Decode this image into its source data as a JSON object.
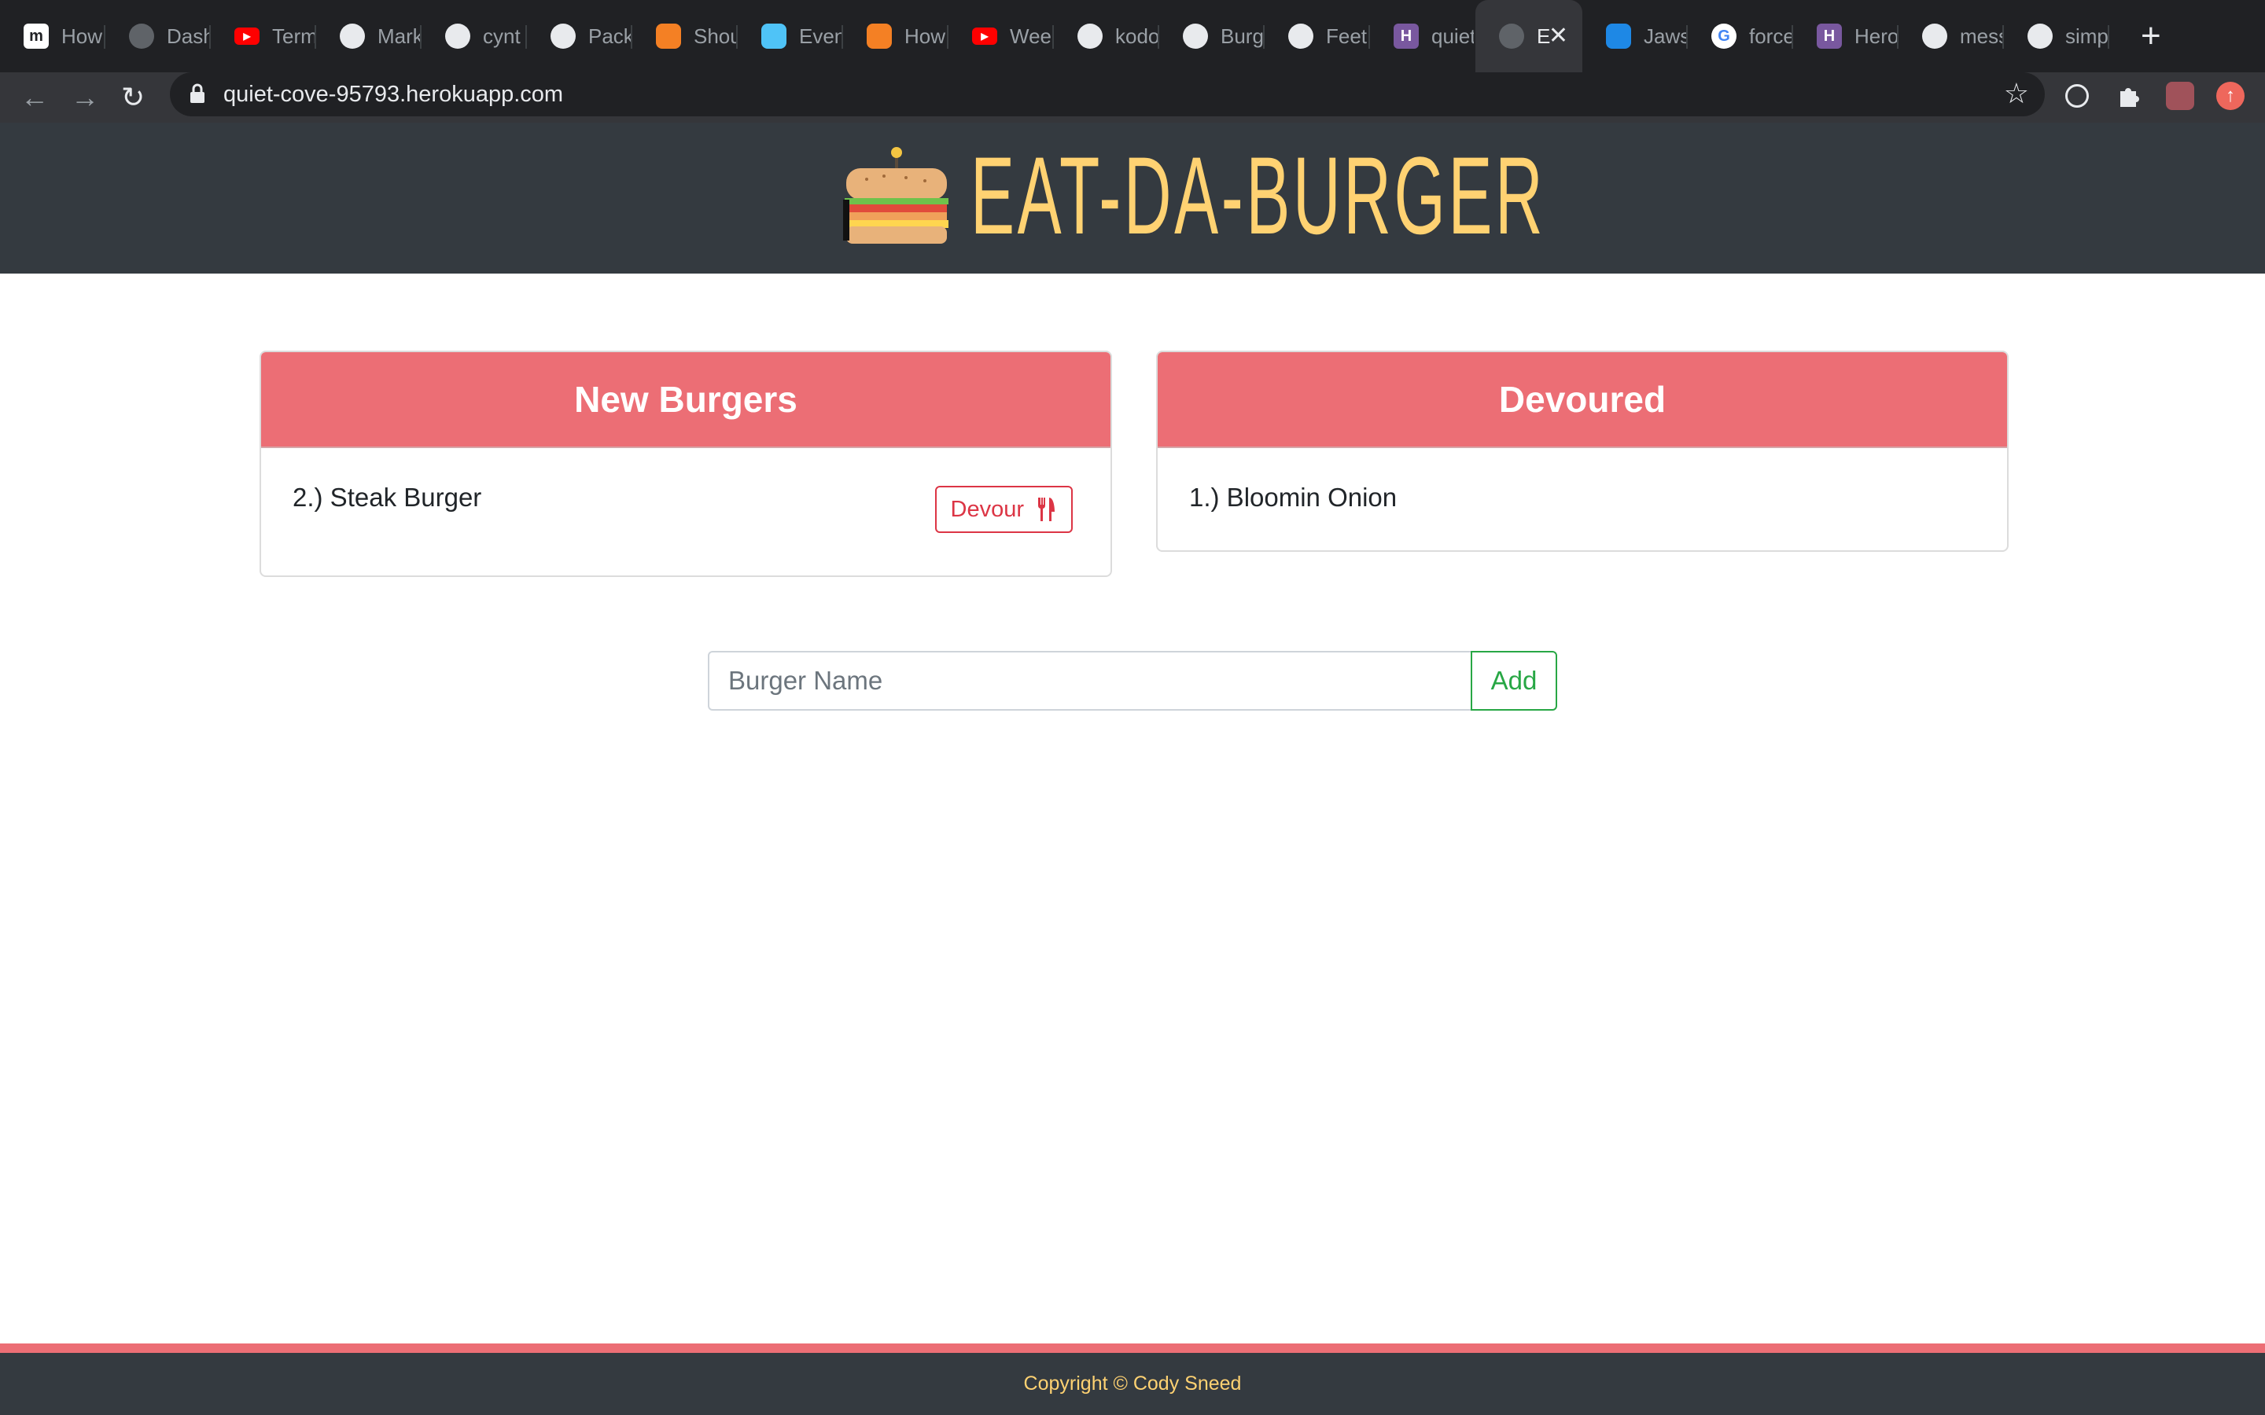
{
  "browser": {
    "tabs": [
      {
        "title": "How",
        "icon": "m-letter-icon",
        "color": "#ffffff"
      },
      {
        "title": "Dash",
        "icon": "globe-icon",
        "color": "#5f6368"
      },
      {
        "title": "Term",
        "icon": "youtube-icon",
        "color": "#ff0000"
      },
      {
        "title": "Mark",
        "icon": "github-icon",
        "color": "#e8eaed"
      },
      {
        "title": "cynt",
        "icon": "github-icon",
        "color": "#e8eaed"
      },
      {
        "title": "Pack",
        "icon": "github-icon",
        "color": "#e8eaed"
      },
      {
        "title": "Shou",
        "icon": "stackoverflow-icon",
        "color": "#f48024"
      },
      {
        "title": "Even",
        "icon": "bird-icon",
        "color": "#4fc3f7"
      },
      {
        "title": "How",
        "icon": "stackoverflow-icon",
        "color": "#f48024"
      },
      {
        "title": "Weel",
        "icon": "youtube-icon",
        "color": "#ff0000"
      },
      {
        "title": "kodo",
        "icon": "github-icon",
        "color": "#e8eaed"
      },
      {
        "title": "Burg",
        "icon": "github-icon",
        "color": "#e8eaed"
      },
      {
        "title": "Feet",
        "icon": "github-icon",
        "color": "#e8eaed"
      },
      {
        "title": "quiet",
        "icon": "heroku-icon",
        "color": "#79589f"
      },
      {
        "title": "E",
        "icon": "globe-icon",
        "color": "#5f6368",
        "active": true
      },
      {
        "title": "Jaws",
        "icon": "jaws-icon",
        "color": "#1e88e5"
      },
      {
        "title": "force",
        "icon": "google-icon",
        "color": "#4285f4"
      },
      {
        "title": "Hero",
        "icon": "heroku-icon",
        "color": "#79589f"
      },
      {
        "title": "mess",
        "icon": "github-icon",
        "color": "#e8eaed"
      },
      {
        "title": "simp",
        "icon": "github-icon",
        "color": "#e8eaed"
      }
    ],
    "url": "quiet-cove-95793.herokuapp.com"
  },
  "header": {
    "title": "EAT-DA-BURGER",
    "title_color": "#ffd272",
    "background": "#343a40"
  },
  "new_burgers": {
    "heading": "New Burgers",
    "items": [
      {
        "label": "2.) Steak Burger",
        "button": "Devour"
      }
    ]
  },
  "devoured": {
    "heading": "Devoured",
    "items": [
      {
        "label": "1.) Bloomin Onion"
      }
    ]
  },
  "form": {
    "placeholder": "Burger Name",
    "value": "",
    "submit_label": "Add"
  },
  "footer": {
    "text": "Copyright © Cody Sneed"
  },
  "colors": {
    "accent": "#ec6e75",
    "danger": "#dc3545",
    "success": "#28a745"
  }
}
